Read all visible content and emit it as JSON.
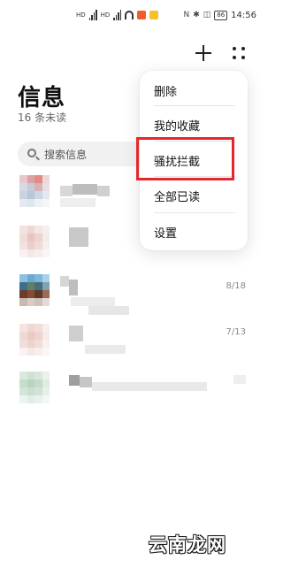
{
  "status_bar": {
    "time": "14:56",
    "battery": "86",
    "network_label_1": "HD",
    "network_label_2": "HD",
    "glyphs": [
      "N",
      "✱",
      "◫"
    ]
  },
  "header": {
    "title": "信息",
    "unread": "16 条未读",
    "add_icon": "plus-icon",
    "more_icon": "more-grid-icon"
  },
  "search": {
    "placeholder": "搜索信息"
  },
  "conversations": [
    {
      "date": ""
    },
    {
      "date": ""
    },
    {
      "date": "8/18"
    },
    {
      "date": "7/13"
    },
    {
      "date": ""
    }
  ],
  "menu": {
    "items": [
      {
        "label": "删除"
      },
      {
        "label": "我的收藏"
      },
      {
        "label": "骚扰拦截"
      },
      {
        "label": "全部已读"
      },
      {
        "label": "设置"
      }
    ],
    "highlighted_index": 2,
    "highlight_color": "#e4282c"
  },
  "watermark": "云南龙网"
}
